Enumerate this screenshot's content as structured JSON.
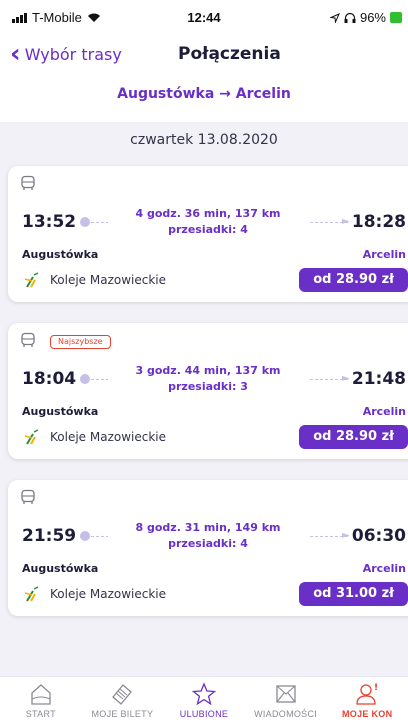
{
  "status_bar": {
    "carrier": "T-Mobile",
    "time": "12:44",
    "battery": "96%"
  },
  "nav": {
    "back_label": "Wybór trasy",
    "title": "Połączenia"
  },
  "route": {
    "from": "Augustówka",
    "arrow": "→",
    "to": "Arcelin"
  },
  "date_label": "czwartek 13.08.2020",
  "connections": [
    {
      "badge": "",
      "departure": "13:52",
      "arrival": "18:28",
      "duration": "4 godz. 36 min, 137 km",
      "transfers": "przesiadki: 4",
      "from": "Augustówka",
      "to": "Arcelin",
      "carrier": "Koleje Mazowieckie",
      "price": "od 28.90 zł"
    },
    {
      "badge": "Najszybsze",
      "departure": "18:04",
      "arrival": "21:48",
      "duration": "3 godz. 44 min, 137 km",
      "transfers": "przesiadki: 3",
      "from": "Augustówka",
      "to": "Arcelin",
      "carrier": "Koleje Mazowieckie",
      "price": "od 28.90 zł"
    },
    {
      "badge": "",
      "departure": "21:59",
      "arrival": "06:30",
      "duration": "8 godz. 31 min, 149 km",
      "transfers": "przesiadki: 4",
      "from": "Augustówka",
      "to": "Arcelin",
      "carrier": "Koleje Mazowieckie",
      "price": "od 31.00 zł"
    }
  ],
  "tabs": [
    {
      "label": "START",
      "icon": "home-icon",
      "state": "normal"
    },
    {
      "label": "MOJE BILETY",
      "icon": "tickets-icon",
      "state": "normal"
    },
    {
      "label": "ULUBIONE",
      "icon": "star-icon",
      "state": "active"
    },
    {
      "label": "WIADOMOŚCI",
      "icon": "mail-icon",
      "state": "normal"
    },
    {
      "label": "MOJE KON",
      "icon": "account-icon",
      "state": "accent"
    }
  ],
  "colors": {
    "accent": "#6a2fc6",
    "badge": "#e8402f",
    "background": "#f1f1f7"
  }
}
